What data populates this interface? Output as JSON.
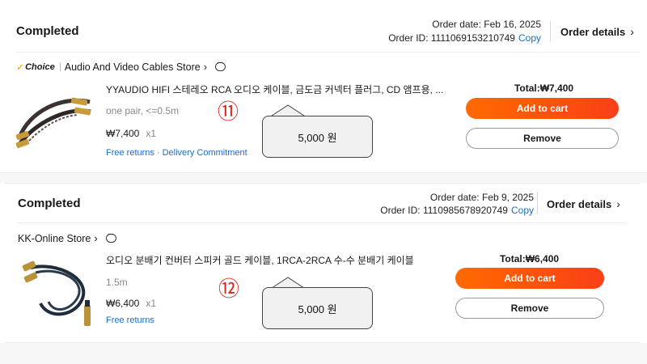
{
  "orders": [
    {
      "status": "Completed",
      "order_date": "Order date: Feb 16, 2025",
      "order_id_label": "Order ID: 1111069153210749",
      "copy_label": "Copy",
      "details_label": "Order details",
      "store": {
        "badge": "Choice",
        "name": "Audio And Video Cables Store"
      },
      "product": {
        "title": "YYAUDIO HIFI 스테레오 RCA 오디오 케이블, 금도금 커넥터 플러그, CD 앰프용, ...",
        "variant": "one pair, <=0.5m",
        "price": "₩7,400",
        "qty": "x1",
        "links": [
          "Free returns",
          "Delivery Commitment"
        ]
      },
      "annotation_number": "⑪",
      "callout": "5,000 원",
      "total": "Total:₩7,400",
      "add_to_cart": "Add to cart",
      "remove": "Remove"
    },
    {
      "status": "Completed",
      "order_date": "Order date: Feb 9, 2025",
      "order_id_label": "Order ID: 1110985678920749",
      "copy_label": "Copy",
      "details_label": "Order details",
      "store": {
        "badge": "",
        "name": "KK-Online Store"
      },
      "product": {
        "title": "오디오 분배기 컨버터 스피커 골드 케이블, 1RCA-2RCA 수-수 분배기 케이블",
        "variant": "1.5m",
        "price": "₩6,400",
        "qty": "x1",
        "links": [
          "Free returns"
        ]
      },
      "annotation_number": "⑫",
      "callout": "5,000 원",
      "total": "Total:₩6,400",
      "add_to_cart": "Add to cart",
      "remove": "Remove"
    }
  ],
  "colors": {
    "accent_orange": "#fa5a12",
    "link_blue": "#1a6fc4",
    "annotation_red": "#d9261c"
  },
  "icons": [
    "chevron-right-icon",
    "chat-icon",
    "choice-check-icon"
  ]
}
